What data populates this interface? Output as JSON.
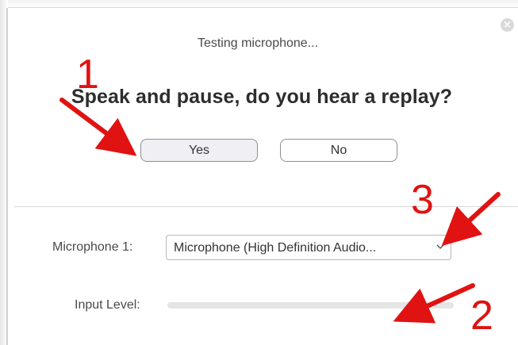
{
  "dialog": {
    "status_text": "Testing microphone...",
    "question": "Speak and pause, do you hear a replay?",
    "close_icon": "close-icon"
  },
  "buttons": {
    "yes_label": "Yes",
    "no_label": "No"
  },
  "microphone": {
    "label": "Microphone 1:",
    "selected": "Microphone (High Definition Audio..."
  },
  "input_level": {
    "label": "Input Level:",
    "level_fraction": 0
  },
  "annotations": {
    "marker_1": "1",
    "marker_2": "2",
    "marker_3": "3",
    "color": "#e11212"
  },
  "colors": {
    "yes_button_bg": "#f0f0f4",
    "divider": "#d8d8d8",
    "level_track": "#e5e5e5"
  }
}
